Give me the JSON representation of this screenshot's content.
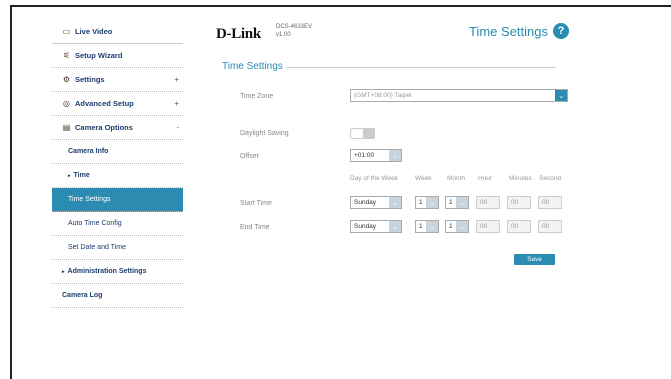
{
  "sidebar": {
    "items": [
      {
        "label": "Live Video",
        "icon": "video-icon"
      },
      {
        "label": "Setup Wizard",
        "icon": "wand-icon"
      },
      {
        "label": "Settings",
        "icon": "gear-icon",
        "sign": "+"
      },
      {
        "label": "Advanced Setup",
        "icon": "advanced-icon",
        "sign": "+"
      },
      {
        "label": "Camera Options",
        "icon": "camera-options-icon",
        "sign": "-"
      }
    ],
    "camera_info": "Camera Info",
    "time": "Time",
    "time_settings": "Time Settings",
    "auto_time_config": "Auto Time Config",
    "set_date_time": "Set Date and Time",
    "admin_settings": "Administration Settings",
    "camera_log": "Camera Log"
  },
  "header": {
    "logo": "D-Link",
    "model": "DCS-4633EV",
    "version": "v1.00",
    "title": "Time Settings",
    "help": "?"
  },
  "section": {
    "title": "Time Settings"
  },
  "form": {
    "time_zone_label": "Time Zone",
    "time_zone_value": "(GMT+08:00) Taipei",
    "daylight_label": "Daylight Saving",
    "offset_label": "Offset",
    "offset_value": "+01:00",
    "columns": [
      "Day of the Week",
      "Week",
      "Month",
      "Hour",
      "Minutes",
      "Second"
    ],
    "start_label": "Start Time",
    "end_label": "End Time",
    "start": {
      "day": "Sunday",
      "week": "1",
      "month": "1",
      "hour": "00",
      "minutes": "00",
      "second": "00"
    },
    "end": {
      "day": "Sunday",
      "week": "1",
      "month": "1",
      "hour": "00",
      "minutes": "00",
      "second": "00"
    },
    "save": "Save"
  },
  "colors": {
    "accent": "#2b8bb0",
    "nav_text": "#1a3d6e"
  }
}
